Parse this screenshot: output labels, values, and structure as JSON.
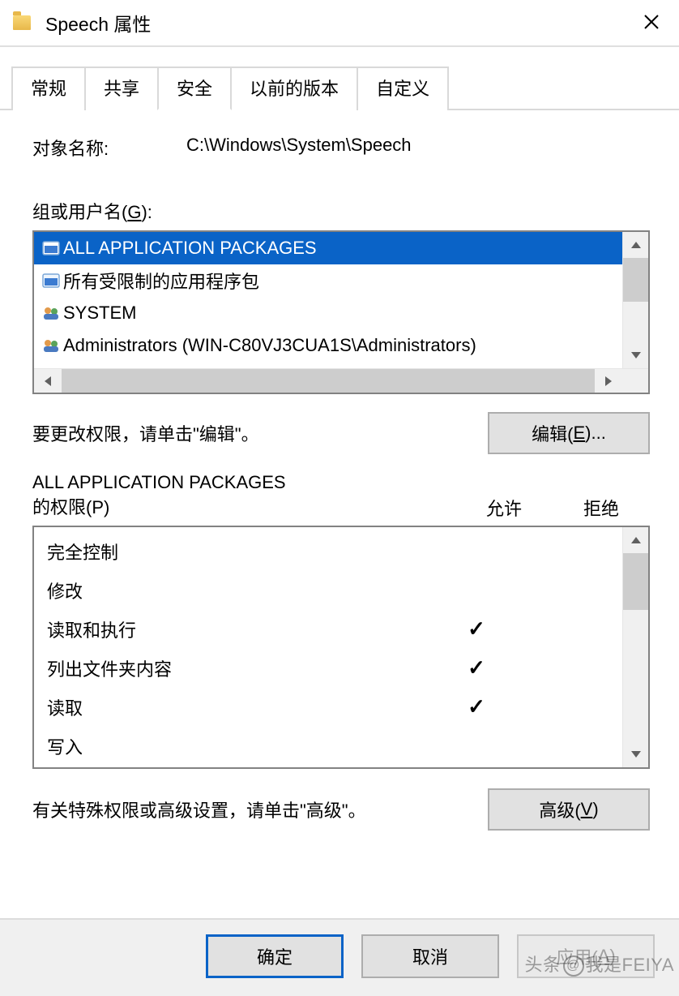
{
  "window": {
    "title": "Speech 属性"
  },
  "tabs": [
    {
      "label": "常规",
      "active": false
    },
    {
      "label": "共享",
      "active": false
    },
    {
      "label": "安全",
      "active": true
    },
    {
      "label": "以前的版本",
      "active": false
    },
    {
      "label": "自定义",
      "active": false
    }
  ],
  "object": {
    "label": "对象名称:",
    "value": "C:\\Windows\\System\\Speech"
  },
  "groups": {
    "label_prefix": "组或用户名(",
    "label_hotkey": "G",
    "label_suffix": "):",
    "items": [
      {
        "name": "ALL APPLICATION PACKAGES",
        "icon": "package",
        "selected": true
      },
      {
        "name": "所有受限制的应用程序包",
        "icon": "package",
        "selected": false
      },
      {
        "name": "SYSTEM",
        "icon": "users",
        "selected": false
      },
      {
        "name": "Administrators (WIN-C80VJ3CUA1S\\Administrators)",
        "icon": "users",
        "selected": false
      }
    ]
  },
  "edit": {
    "hint": "要更改权限，请单击\"编辑\"。",
    "button_prefix": "编辑(",
    "button_hotkey": "E",
    "button_suffix": ")..."
  },
  "permissions": {
    "title_line1": "ALL APPLICATION PACKAGES",
    "title_line2_prefix": "的权限(",
    "title_line2_hotkey": "P",
    "title_line2_suffix": ")",
    "col_allow": "允许",
    "col_deny": "拒绝",
    "rows": [
      {
        "name": "完全控制",
        "allow": false,
        "deny": false
      },
      {
        "name": "修改",
        "allow": false,
        "deny": false
      },
      {
        "name": "读取和执行",
        "allow": true,
        "deny": false
      },
      {
        "name": "列出文件夹内容",
        "allow": true,
        "deny": false
      },
      {
        "name": "读取",
        "allow": true,
        "deny": false
      },
      {
        "name": "写入",
        "allow": false,
        "deny": false
      }
    ]
  },
  "advanced": {
    "hint": "有关特殊权限或高级设置，请单击\"高级\"。",
    "button_prefix": "高级(",
    "button_hotkey": "V",
    "button_suffix": ")"
  },
  "footer": {
    "ok": "确定",
    "cancel": "取消",
    "apply_prefix": "应用(",
    "apply_hotkey": "A",
    "apply_suffix": ")"
  },
  "watermark": {
    "left": "头条",
    "mid": "我是",
    "right": "FEIYA"
  }
}
